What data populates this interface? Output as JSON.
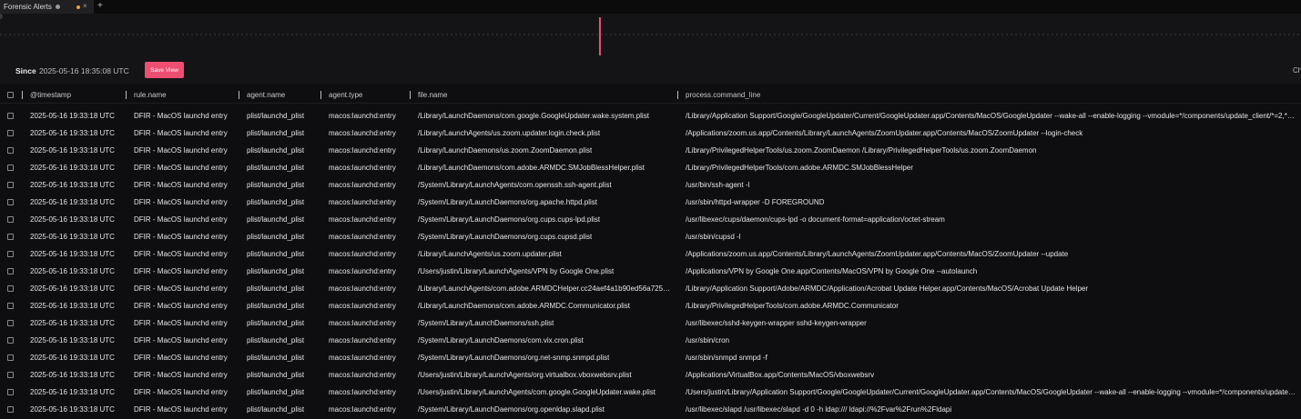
{
  "tab": {
    "title": "Forensic Alerts"
  },
  "toolbar": {
    "since_label": "Since",
    "since_value": "2025-05-16 18:35:08 UTC",
    "save_view_label": "Save View",
    "edge_text": "Ch"
  },
  "colors": {
    "accent": "#ec4f72",
    "tab_dot": "#e8a23a",
    "background": "#0e0e10"
  },
  "chart_data": {
    "type": "bar",
    "bars": [
      {
        "x": "2025-05-16 19:33:18 UTC"
      }
    ]
  },
  "table": {
    "columns": [
      "@timestamp",
      "rule.name",
      "agent.name",
      "agent.type",
      "file.name",
      "process.command_line"
    ],
    "rows": [
      [
        "2025-05-16 19:33:18 UTC",
        "DFIR - MacOS launchd entry",
        "plist/launchd_plist",
        "macos:launchd:entry",
        "/Library/LaunchDaemons/com.google.GoogleUpdater.wake.system.plist",
        "/Library/Application Support/Google/GoogleUpdater/Current/GoogleUpdater.app/Contents/MacOS/GoogleUpdater --wake-all --enable-logging --vmodule=*/components/update_client/*=2,*/chr..."
      ],
      [
        "2025-05-16 19:33:18 UTC",
        "DFIR - MacOS launchd entry",
        "plist/launchd_plist",
        "macos:launchd:entry",
        "/Library/LaunchAgents/us.zoom.updater.login.check.plist",
        "/Applications/zoom.us.app/Contents/Library/LaunchAgents/ZoomUpdater.app/Contents/MacOS/ZoomUpdater --login-check"
      ],
      [
        "2025-05-16 19:33:18 UTC",
        "DFIR - MacOS launchd entry",
        "plist/launchd_plist",
        "macos:launchd:entry",
        "/Library/LaunchDaemons/us.zoom.ZoomDaemon.plist",
        "/Library/PrivilegedHelperTools/us.zoom.ZoomDaemon /Library/PrivilegedHelperTools/us.zoom.ZoomDaemon"
      ],
      [
        "2025-05-16 19:33:18 UTC",
        "DFIR - MacOS launchd entry",
        "plist/launchd_plist",
        "macos:launchd:entry",
        "/Library/LaunchDaemons/com.adobe.ARMDC.SMJobBlessHelper.plist",
        "/Library/PrivilegedHelperTools/com.adobe.ARMDC.SMJobBlessHelper"
      ],
      [
        "2025-05-16 19:33:18 UTC",
        "DFIR - MacOS launchd entry",
        "plist/launchd_plist",
        "macos:launchd:entry",
        "/System/Library/LaunchAgents/com.openssh.ssh-agent.plist",
        "/usr/bin/ssh-agent -l"
      ],
      [
        "2025-05-16 19:33:18 UTC",
        "DFIR - MacOS launchd entry",
        "plist/launchd_plist",
        "macos:launchd:entry",
        "/System/Library/LaunchDaemons/org.apache.httpd.plist",
        "/usr/sbin/httpd-wrapper -D FOREGROUND"
      ],
      [
        "2025-05-16 19:33:18 UTC",
        "DFIR - MacOS launchd entry",
        "plist/launchd_plist",
        "macos:launchd:entry",
        "/System/Library/LaunchDaemons/org.cups.cups-lpd.plist",
        "/usr/libexec/cups/daemon/cups-lpd -o document-format=application/octet-stream"
      ],
      [
        "2025-05-16 19:33:18 UTC",
        "DFIR - MacOS launchd entry",
        "plist/launchd_plist",
        "macos:launchd:entry",
        "/System/Library/LaunchDaemons/org.cups.cupsd.plist",
        "/usr/sbin/cupsd -l"
      ],
      [
        "2025-05-16 19:33:18 UTC",
        "DFIR - MacOS launchd entry",
        "plist/launchd_plist",
        "macos:launchd:entry",
        "/Library/LaunchAgents/us.zoom.updater.plist",
        "/Applications/zoom.us.app/Contents/Library/LaunchAgents/ZoomUpdater.app/Contents/MacOS/ZoomUpdater --update"
      ],
      [
        "2025-05-16 19:33:18 UTC",
        "DFIR - MacOS launchd entry",
        "plist/launchd_plist",
        "macos:launchd:entry",
        "/Users/justin/Library/LaunchAgents/VPN by Google One.plist",
        "/Applications/VPN by Google One.app/Contents/MacOS/VPN by Google One --autolaunch"
      ],
      [
        "2025-05-16 19:33:18 UTC",
        "DFIR - MacOS launchd entry",
        "plist/launchd_plist",
        "macos:launchd:entry",
        "/Library/LaunchAgents/com.adobe.ARMDCHelper.cc24aef4a1b90ed56a725c3...",
        "/Library/Application Support/Adobe/ARMDC/Application/Acrobat Update Helper.app/Contents/MacOS/Acrobat Update Helper"
      ],
      [
        "2025-05-16 19:33:18 UTC",
        "DFIR - MacOS launchd entry",
        "plist/launchd_plist",
        "macos:launchd:entry",
        "/Library/LaunchDaemons/com.adobe.ARMDC.Communicator.plist",
        "/Library/PrivilegedHelperTools/com.adobe.ARMDC.Communicator"
      ],
      [
        "2025-05-16 19:33:18 UTC",
        "DFIR - MacOS launchd entry",
        "plist/launchd_plist",
        "macos:launchd:entry",
        "/System/Library/LaunchDaemons/ssh.plist",
        "/usr/libexec/sshd-keygen-wrapper sshd-keygen-wrapper"
      ],
      [
        "2025-05-16 19:33:18 UTC",
        "DFIR - MacOS launchd entry",
        "plist/launchd_plist",
        "macos:launchd:entry",
        "/System/Library/LaunchDaemons/com.vix.cron.plist",
        "/usr/sbin/cron"
      ],
      [
        "2025-05-16 19:33:18 UTC",
        "DFIR - MacOS launchd entry",
        "plist/launchd_plist",
        "macos:launchd:entry",
        "/System/Library/LaunchDaemons/org.net-snmp.snmpd.plist",
        "/usr/sbin/snmpd snmpd -f"
      ],
      [
        "2025-05-16 19:33:18 UTC",
        "DFIR - MacOS launchd entry",
        "plist/launchd_plist",
        "macos:launchd:entry",
        "/Users/justin/Library/LaunchAgents/org.virtualbox.vboxwebsrv.plist",
        "/Applications/VirtualBox.app/Contents/MacOS/vboxwebsrv"
      ],
      [
        "2025-05-16 19:33:18 UTC",
        "DFIR - MacOS launchd entry",
        "plist/launchd_plist",
        "macos:launchd:entry",
        "/Users/justin/Library/LaunchAgents/com.google.GoogleUpdater.wake.plist",
        "/Users/justin/Library/Application Support/Google/GoogleUpdater/Current/GoogleUpdater.app/Contents/MacOS/GoogleUpdater --wake-all --enable-logging --vmodule=*/components/update_cli..."
      ],
      [
        "2025-05-16 19:33:18 UTC",
        "DFIR - MacOS launchd entry",
        "plist/launchd_plist",
        "macos:launchd:entry",
        "/System/Library/LaunchDaemons/org.openldap.slapd.plist",
        "/usr/libexec/slapd /usr/libexec/slapd -d 0 -h ldap:/// ldapi://%2Fvar%2Frun%2Fldapi"
      ]
    ]
  }
}
